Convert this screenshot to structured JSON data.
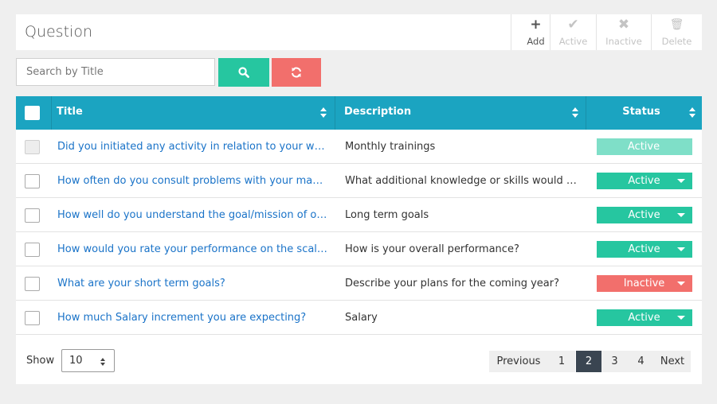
{
  "header": {
    "title": "Question",
    "toolbar": [
      {
        "label": "Add",
        "icon": "+",
        "icon_name": "plus-icon",
        "enabled": true
      },
      {
        "label": "Active",
        "icon": "✔",
        "icon_name": "check-icon",
        "enabled": false
      },
      {
        "label": "Inactive",
        "icon": "✖",
        "icon_name": "close-icon",
        "enabled": false
      },
      {
        "label": "Delete",
        "icon": "🗑",
        "icon_name": "trash-icon",
        "enabled": false
      }
    ]
  },
  "search": {
    "placeholder": "Search by Title",
    "value": ""
  },
  "table": {
    "columns": [
      "Title",
      "Description",
      "Status"
    ],
    "rows": [
      {
        "title": "Did you initiated any activity in relation to your work...",
        "description": "Monthly trainings",
        "status": "Active",
        "selectable": false
      },
      {
        "title": "How often do you consult problems with your mana...",
        "description": "What additional knowledge or skills would ma...",
        "status": "Active",
        "selectable": true
      },
      {
        "title": "How well do you understand the goal/mission of our...",
        "description": "Long term goals",
        "status": "Active",
        "selectable": true
      },
      {
        "title": "How would you rate your performance on the scale...",
        "description": "How is your overall performance?",
        "status": "Active",
        "selectable": true
      },
      {
        "title": "What are your short term goals?",
        "description": "Describe your plans for the coming year?",
        "status": "Inactive",
        "selectable": true
      },
      {
        "title": "How much Salary increment you are expecting?",
        "description": "Salary",
        "status": "Active",
        "selectable": true
      }
    ]
  },
  "footer": {
    "show_label": "Show",
    "page_size": "10",
    "pagination": {
      "previous": "Previous",
      "next": "Next",
      "pages": [
        "1",
        "2",
        "3",
        "4"
      ],
      "current": "2"
    }
  },
  "colors": {
    "header_bg": "#1ba4c1",
    "active": "#26c6a0",
    "inactive": "#f26f6c",
    "link": "#1a73c8",
    "current_page": "#3a4551"
  }
}
